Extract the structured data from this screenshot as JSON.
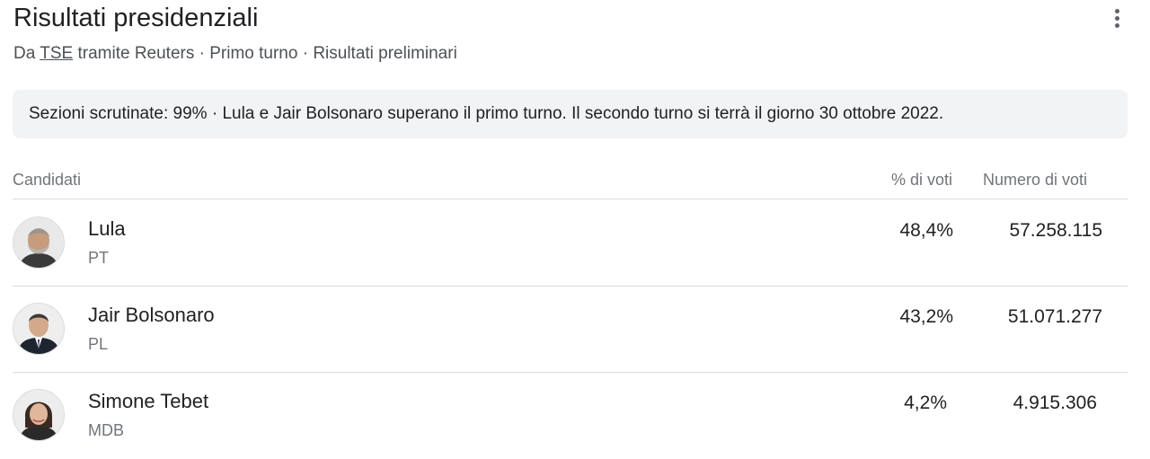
{
  "header": {
    "title": "Risultati presidenziali",
    "subtitle_prefix": "Da",
    "source_link": "TSE",
    "subtitle_suffix": "tramite Reuters · Primo turno · Risultati preliminari",
    "more_icon": "more-vert-icon"
  },
  "notice": "Sezioni scrutinate: 99% · Lula e Jair Bolsonaro superano il primo turno. Il secondo turno si terrà il giorno 30 ottobre 2022.",
  "table": {
    "columns": {
      "candidates": "Candidati",
      "percent": "% di voti",
      "votes": "Numero di voti"
    },
    "rows": [
      {
        "name": "Lula",
        "party": "PT",
        "percent": "48,4%",
        "votes": "57.258.115"
      },
      {
        "name": "Jair Bolsonaro",
        "party": "PL",
        "percent": "43,2%",
        "votes": "51.071.277"
      },
      {
        "name": "Simone Tebet",
        "party": "MDB",
        "percent": "4,2%",
        "votes": "4.915.306"
      }
    ]
  },
  "colors": {
    "notice_bg": "#f1f3f4",
    "divider": "#dadce0",
    "secondary_text": "#70757a"
  }
}
